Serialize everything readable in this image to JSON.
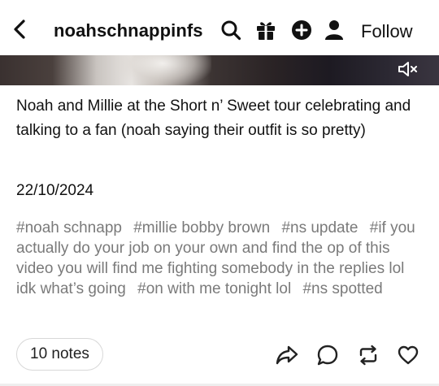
{
  "header": {
    "blog_name": "noahschnappinfs",
    "follow_label": "Follow",
    "icons": [
      "back-arrow-icon",
      "search-icon",
      "gift-icon",
      "add-circle-icon",
      "person-icon"
    ]
  },
  "media": {
    "mute_icon": "volume-muted-icon"
  },
  "post": {
    "caption": "Noah and Millie at the Short n’ Sweet tour celebrating and talking to a fan (noah saying their outfit is so pretty)",
    "date": "22/10/2024",
    "tags": [
      "#noah schnapp",
      "#millie bobby brown",
      "#ns update",
      "#if you actually do your job on your own and find the op of this video you will find me fighting somebody in the replies lol idk what’s going",
      "#on with me tonight lol",
      "#ns spotted"
    ]
  },
  "footer": {
    "notes_label": "10 notes",
    "actions": [
      "share-icon",
      "reply-icon",
      "reblog-icon",
      "like-icon"
    ]
  },
  "colors": {
    "text": "#111111",
    "tag_text": "#7a7a7a",
    "border": "#d8d8d8"
  }
}
